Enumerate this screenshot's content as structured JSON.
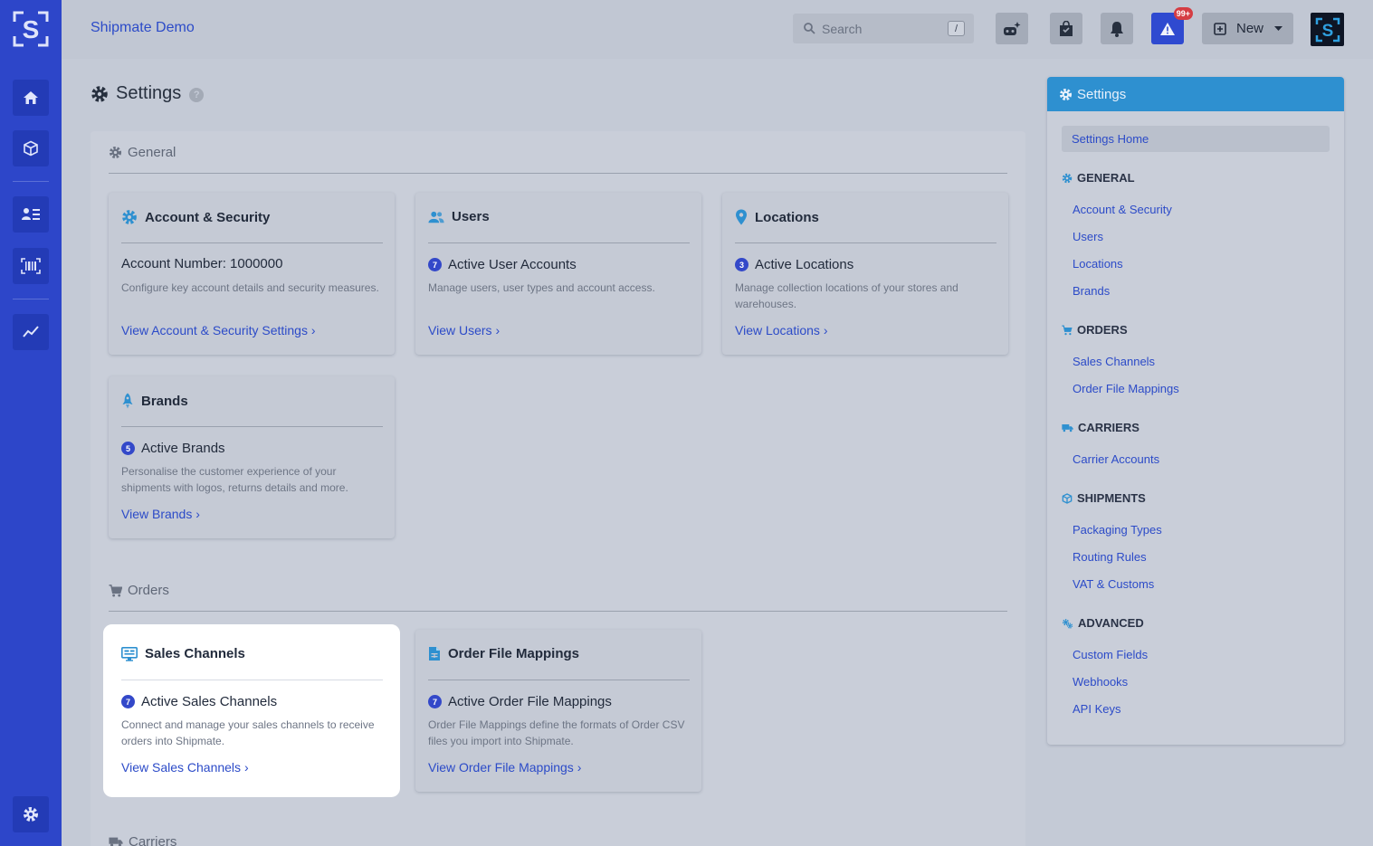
{
  "app": {
    "name": "Shipmate Demo"
  },
  "topbar": {
    "search_placeholder": "Search",
    "search_shortcut": "/",
    "alerts_badge": "99+",
    "new_label": "New"
  },
  "page": {
    "title": "Settings"
  },
  "sections": {
    "general": {
      "title": "General",
      "cards": [
        {
          "title": "Account & Security",
          "subtitle": "Account Number: 1000000",
          "description": "Configure key account details and security measures.",
          "link": "View Account & Security Settings"
        },
        {
          "title": "Users",
          "count": "7",
          "subtitle": "Active User Accounts",
          "description": "Manage users, user types and account access.",
          "link": "View Users"
        },
        {
          "title": "Locations",
          "count": "3",
          "subtitle": "Active Locations",
          "description": "Manage collection locations of your stores and warehouses.",
          "link": "View Locations"
        },
        {
          "title": "Brands",
          "count": "5",
          "subtitle": "Active Brands",
          "description": "Personalise the customer experience of your shipments with logos, returns details and more.",
          "link": "View Brands"
        }
      ]
    },
    "orders": {
      "title": "Orders",
      "cards": [
        {
          "title": "Sales Channels",
          "count": "7",
          "subtitle": "Active Sales Channels",
          "description": "Connect and manage your sales channels to receive orders into Shipmate.",
          "link": "View Sales Channels"
        },
        {
          "title": "Order File Mappings",
          "count": "7",
          "subtitle": "Active Order File Mappings",
          "description": "Order File Mappings define the formats of Order CSV files you import into Shipmate.",
          "link": "View Order File Mappings"
        }
      ]
    },
    "carriers": {
      "title": "Carriers"
    }
  },
  "sidebar": {
    "title": "Settings",
    "home": "Settings Home",
    "groups": [
      {
        "title": "GENERAL",
        "items": [
          "Account & Security",
          "Users",
          "Locations",
          "Brands"
        ]
      },
      {
        "title": "ORDERS",
        "items": [
          "Sales Channels",
          "Order File Mappings"
        ]
      },
      {
        "title": "CARRIERS",
        "items": [
          "Carrier Accounts"
        ]
      },
      {
        "title": "SHIPMENTS",
        "items": [
          "Packaging Types",
          "Routing Rules",
          "VAT & Customs"
        ]
      },
      {
        "title": "ADVANCED",
        "items": [
          "Custom Fields",
          "Webhooks",
          "API Keys"
        ]
      }
    ]
  },
  "colors": {
    "accent": "#2c4bc8",
    "rail": "#2d46c9",
    "sidebar_header": "#2e90d0",
    "badge": "#d53d43"
  }
}
